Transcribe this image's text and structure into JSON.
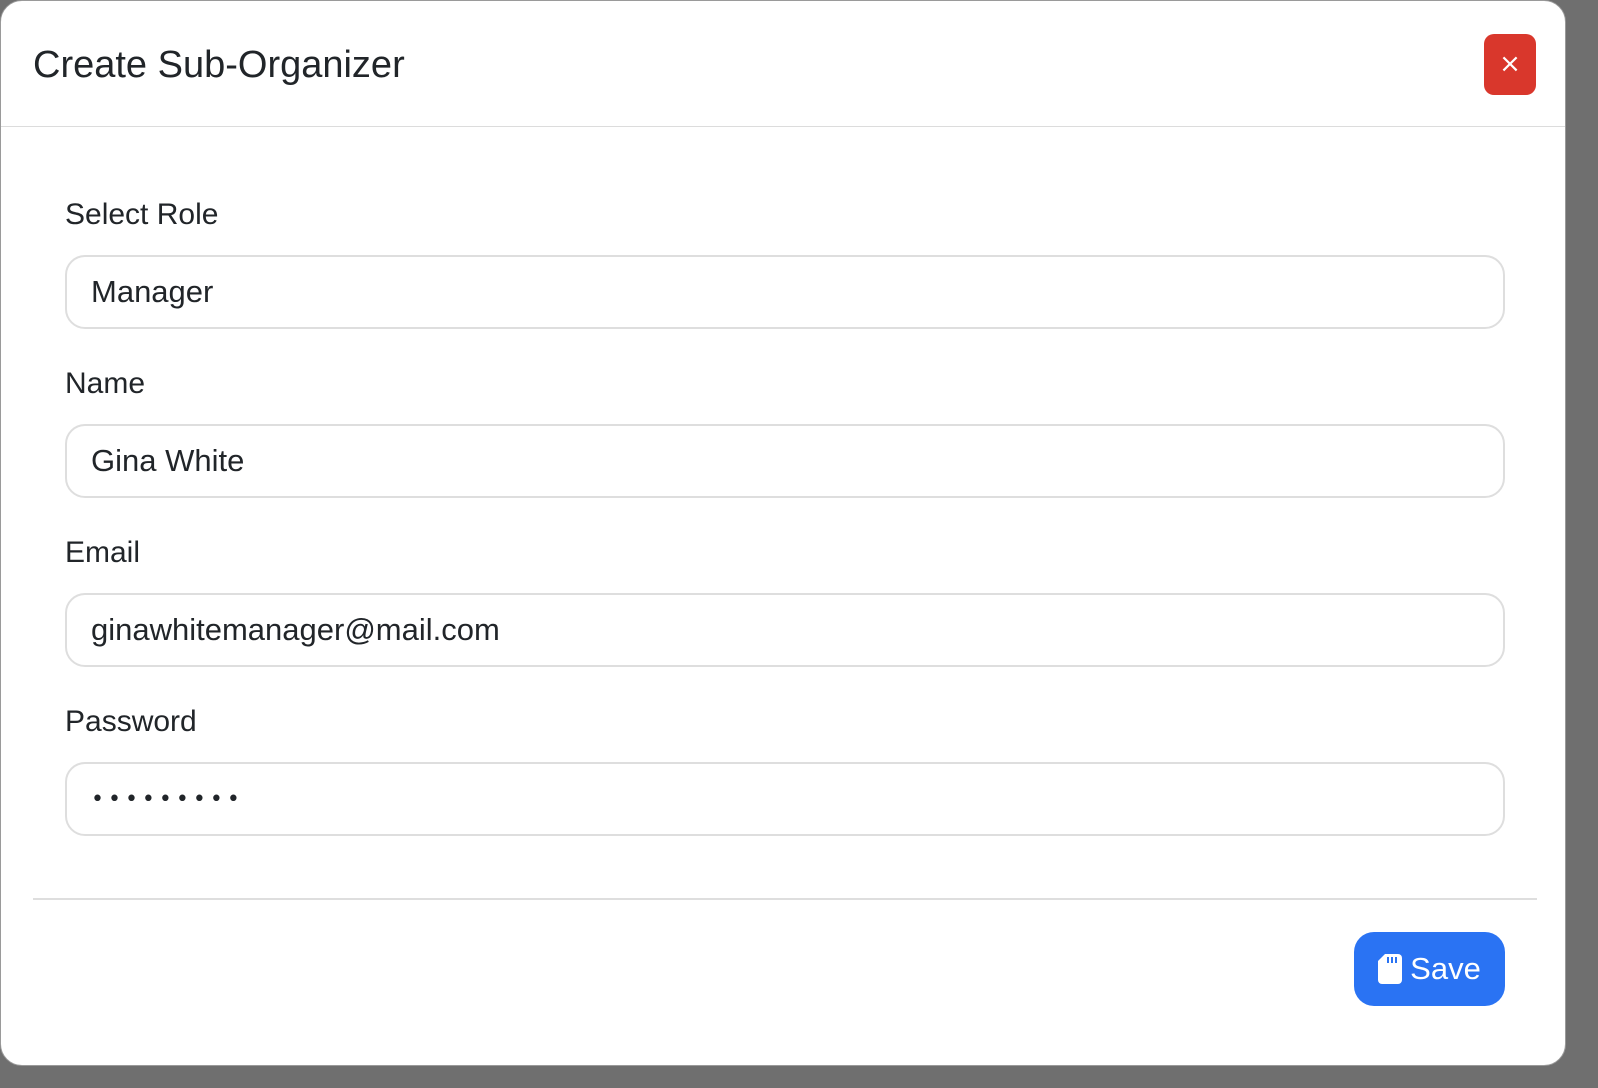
{
  "modal": {
    "title": "Create Sub-Organizer",
    "close_label": "×"
  },
  "form": {
    "role": {
      "label": "Select Role",
      "value": "Manager"
    },
    "name": {
      "label": "Name",
      "value": "Gina White"
    },
    "email": {
      "label": "Email",
      "value": "ginawhitemanager@mail.com"
    },
    "password": {
      "label": "Password",
      "value": "•••••••••"
    }
  },
  "footer": {
    "save_label": "Save",
    "save_icon": "sd-card-icon"
  },
  "colors": {
    "close_button": "#d9372c",
    "save_button": "#2a73f3"
  }
}
